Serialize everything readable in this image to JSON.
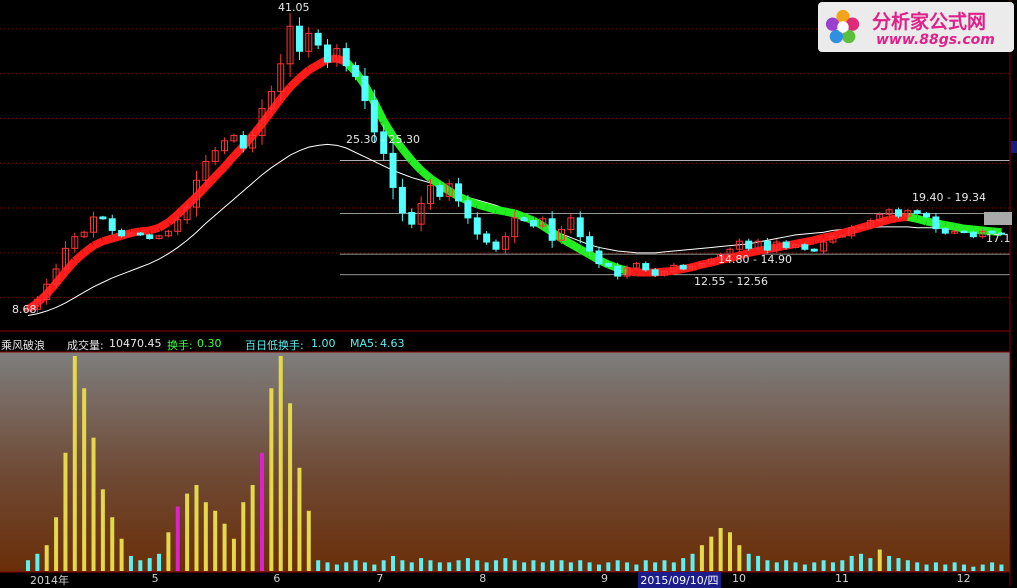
{
  "logo": {
    "name": "分析家公式网",
    "url": "www.88gs.com"
  },
  "indicator_bar": {
    "name": "乘风破浪",
    "volume_label": "成交量:",
    "volume_value": "10470.45",
    "turnover_label": "换手:",
    "turnover_value": "0.30",
    "low_turnover_label": "百日低换手:",
    "low_turnover_value": "1.00",
    "ma5_label": "MA5:",
    "ma5_value": "4.63"
  },
  "price_labels": {
    "high": "41.05",
    "low_start": "8.68",
    "last": "17.1",
    "zone1": "25.30 - 25.30",
    "zone2": "14.80 - 14.90",
    "zone3": "12.55 - 12.56",
    "zone4": "19.40 - 19.34"
  },
  "colors": {
    "up": "#ff3333",
    "down": "#54ffff",
    "trend_up": "#ff1a1a",
    "trend_down": "#22ee22",
    "ma": "#ffffff",
    "vol_bar": "#e5d84a",
    "vol_low": "#5ef0f0",
    "vol_magenta": "#dd22cc",
    "hline": "#c01010",
    "grid": "#8a0000"
  },
  "chart_data": {
    "type": "candlestick",
    "title": "",
    "x_ticks": [
      {
        "label": "2014年",
        "i": 0
      },
      {
        "label": "5",
        "i": 13
      },
      {
        "label": "6",
        "i": 26
      },
      {
        "label": "7",
        "i": 37
      },
      {
        "label": "8",
        "i": 48
      },
      {
        "label": "9",
        "i": 61
      },
      {
        "label": "2015/09/10/四",
        "i": 65
      },
      {
        "label": "10",
        "i": 75
      },
      {
        "label": "11",
        "i": 86
      },
      {
        "label": "12",
        "i": 99
      }
    ],
    "ylim": [
      7.5,
      43
    ],
    "horizontal_levels": [
      25.3,
      19.4,
      14.85,
      12.55
    ],
    "closes": [
      8.7,
      9.8,
      11.5,
      13.2,
      15.5,
      16.8,
      17.3,
      19.0,
      18.8,
      17.5,
      16.9,
      17.2,
      17.0,
      16.6,
      16.9,
      17.4,
      18.7,
      20.1,
      23.1,
      25.2,
      26.4,
      27.5,
      28.1,
      26.7,
      28.1,
      31.1,
      33.0,
      36.1,
      40.3,
      37.5,
      39.5,
      38.2,
      36.3,
      37.8,
      35.9,
      34.7,
      32.0,
      28.5,
      26.1,
      22.3,
      19.5,
      18.2,
      20.5,
      22.5,
      21.3,
      22.7,
      20.8,
      18.9,
      17.1,
      16.2,
      15.4,
      16.8,
      18.9,
      18.6,
      18.0,
      18.8,
      16.4,
      17.6,
      18.9,
      16.8,
      15.2,
      13.8,
      13.5,
      12.4,
      13.3,
      13.8,
      13.1,
      12.5,
      12.9,
      13.6,
      13.2,
      13.5,
      13.8,
      14.3,
      14.8,
      15.4,
      16.3,
      15.5,
      16.3,
      15.3,
      16.2,
      15.6,
      15.9,
      15.4,
      15.2,
      16.2,
      16.8,
      16.9,
      17.8,
      17.9,
      18.6,
      19.3,
      19.8,
      19.1,
      19.7,
      19.4,
      19.0,
      17.7,
      17.2,
      17.4,
      17.3,
      16.8,
      17.4,
      17.2,
      17.1
    ],
    "trend_line": [
      8.7,
      9.4,
      10.4,
      11.6,
      12.9,
      14.1,
      15.0,
      15.8,
      16.3,
      16.6,
      16.9,
      17.2,
      17.4,
      17.5,
      17.8,
      18.4,
      19.3,
      20.3,
      21.3,
      22.4,
      23.5,
      24.6,
      25.8,
      26.9,
      28.1,
      29.4,
      30.8,
      32.2,
      33.5,
      34.5,
      35.4,
      36.0,
      36.6,
      36.7,
      36.3,
      35.2,
      33.7,
      31.8,
      29.7,
      28.0,
      26.6,
      25.3,
      24.2,
      23.3,
      22.6,
      21.9,
      21.3,
      20.8,
      20.4,
      20.1,
      19.8,
      19.6,
      19.4,
      19.0,
      18.6,
      18.0,
      17.3,
      16.6,
      16.0,
      15.4,
      14.8,
      14.2,
      13.7,
      13.3,
      13.0,
      12.8,
      12.8,
      12.8,
      12.9,
      13.0,
      13.2,
      13.4,
      13.7,
      13.9,
      14.2,
      14.4,
      14.7,
      15.0,
      15.2,
      15.4,
      15.6,
      15.8,
      16.0,
      16.2,
      16.4,
      16.7,
      16.9,
      17.2,
      17.5,
      17.8,
      18.1,
      18.4,
      18.7,
      18.9,
      19.0,
      18.8,
      18.5,
      18.3,
      18.1,
      17.9,
      17.7,
      17.6,
      17.5,
      17.4,
      17.3
    ],
    "trend_dir": [
      1,
      1,
      1,
      1,
      1,
      1,
      1,
      1,
      1,
      1,
      1,
      1,
      1,
      1,
      1,
      1,
      1,
      1,
      1,
      1,
      1,
      1,
      1,
      1,
      1,
      1,
      1,
      1,
      1,
      1,
      1,
      1,
      1,
      1,
      -1,
      -1,
      -1,
      -1,
      -1,
      -1,
      -1,
      -1,
      -1,
      -1,
      -1,
      -1,
      -1,
      -1,
      -1,
      -1,
      -1,
      -1,
      -1,
      -1,
      -1,
      -1,
      -1,
      -1,
      -1,
      -1,
      -1,
      -1,
      -1,
      -1,
      1,
      1,
      1,
      1,
      1,
      1,
      1,
      1,
      1,
      1,
      1,
      1,
      1,
      1,
      1,
      1,
      1,
      1,
      1,
      1,
      1,
      1,
      1,
      1,
      1,
      1,
      1,
      1,
      1,
      1,
      -1,
      -1,
      -1,
      -1,
      -1,
      -1,
      -1,
      -1,
      -1,
      -1
    ],
    "ma_line": [
      8.0,
      8.2,
      8.5,
      8.9,
      9.4,
      10.0,
      10.6,
      11.2,
      11.7,
      12.2,
      12.6,
      13.0,
      13.4,
      13.8,
      14.3,
      14.9,
      15.6,
      16.4,
      17.3,
      18.3,
      19.2,
      20.1,
      21.0,
      21.9,
      22.8,
      23.7,
      24.5,
      25.2,
      25.9,
      26.4,
      26.8,
      27.0,
      27.1,
      27.0,
      26.7,
      26.2,
      25.7,
      25.2,
      24.7,
      24.2,
      23.8,
      23.4,
      23.1,
      22.8,
      22.4,
      22.0,
      21.6,
      21.2,
      20.9,
      20.6,
      20.3,
      19.9,
      19.5,
      19.0,
      18.6,
      18.1,
      17.6,
      17.1,
      16.7,
      16.3,
      15.9,
      15.6,
      15.4,
      15.2,
      15.1,
      15.0,
      15.0,
      15.0,
      15.1,
      15.2,
      15.3,
      15.4,
      15.5,
      15.6,
      15.7,
      15.8,
      15.9,
      16.0,
      16.2,
      16.4,
      16.6,
      16.8,
      17.0,
      17.1,
      17.2,
      17.3,
      17.5,
      17.6,
      17.7,
      17.8,
      17.8,
      17.9,
      17.9,
      17.9,
      17.9,
      17.8,
      17.8,
      17.8,
      17.7,
      17.7,
      17.6,
      17.6,
      17.6,
      17.5,
      17.5
    ],
    "volume": [
      0.05,
      0.08,
      0.12,
      0.25,
      0.55,
      1.0,
      0.85,
      0.62,
      0.38,
      0.25,
      0.15,
      0.07,
      0.05,
      0.06,
      0.08,
      0.18,
      0.3,
      0.36,
      0.4,
      0.32,
      0.28,
      0.22,
      0.15,
      0.32,
      0.4,
      0.55,
      0.85,
      1.0,
      0.78,
      0.48,
      0.28,
      0.05,
      0.04,
      0.03,
      0.04,
      0.05,
      0.04,
      0.03,
      0.05,
      0.07,
      0.05,
      0.04,
      0.06,
      0.05,
      0.04,
      0.04,
      0.05,
      0.06,
      0.05,
      0.04,
      0.05,
      0.06,
      0.05,
      0.04,
      0.05,
      0.04,
      0.05,
      0.05,
      0.04,
      0.05,
      0.04,
      0.03,
      0.04,
      0.05,
      0.04,
      0.03,
      0.05,
      0.04,
      0.05,
      0.04,
      0.06,
      0.08,
      0.12,
      0.16,
      0.2,
      0.18,
      0.12,
      0.08,
      0.07,
      0.05,
      0.04,
      0.05,
      0.04,
      0.03,
      0.04,
      0.05,
      0.04,
      0.05,
      0.07,
      0.08,
      0.06,
      0.1,
      0.07,
      0.06,
      0.05,
      0.04,
      0.03,
      0.04,
      0.03,
      0.04,
      0.03,
      0.02,
      0.03,
      0.04,
      0.03
    ]
  }
}
